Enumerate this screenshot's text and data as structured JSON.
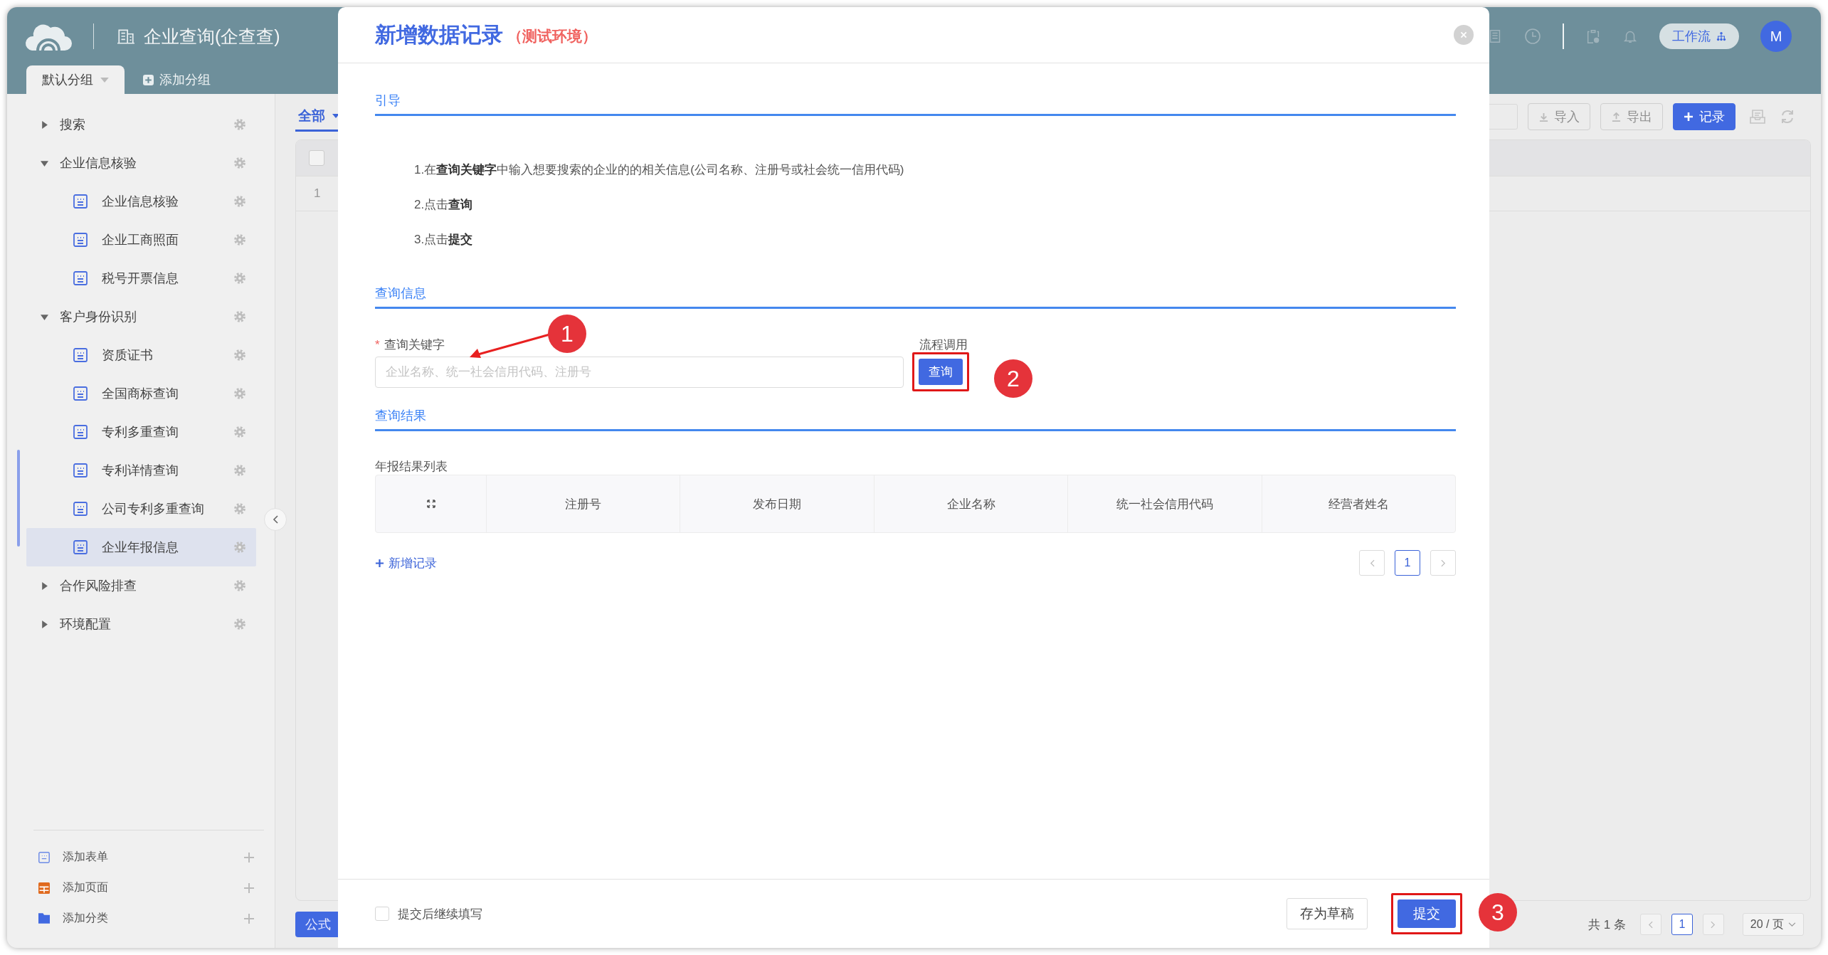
{
  "app": {
    "title": "企业查询(企查查)",
    "group_tab": {
      "label": "默认分组",
      "selected": true
    },
    "add_group_button": "添加分组",
    "workflow_button": "工作流",
    "avatar": "M"
  },
  "sidebar": {
    "tree": [
      {
        "label": "搜索",
        "kind": "folder",
        "expanded": false,
        "selected": false
      },
      {
        "label": "企业信息核验",
        "kind": "folder",
        "expanded": true,
        "selected": false,
        "children": [
          {
            "label": "企业信息核验",
            "kind": "form",
            "selected": false
          },
          {
            "label": "企业工商照面",
            "kind": "form",
            "selected": false
          },
          {
            "label": "税号开票信息",
            "kind": "form",
            "selected": false
          }
        ]
      },
      {
        "label": "客户身份识别",
        "kind": "folder",
        "expanded": true,
        "selected": false,
        "children": [
          {
            "label": "资质证书",
            "kind": "form",
            "selected": false
          },
          {
            "label": "全国商标查询",
            "kind": "form",
            "selected": false
          },
          {
            "label": "专利多重查询",
            "kind": "form",
            "selected": false
          },
          {
            "label": "专利详情查询",
            "kind": "form",
            "selected": false
          },
          {
            "label": "公司专利多重查询",
            "kind": "form",
            "selected": false
          },
          {
            "label": "企业年报信息",
            "kind": "form",
            "selected": true
          }
        ]
      },
      {
        "label": "合作风险排查",
        "kind": "folder",
        "expanded": false,
        "selected": false
      },
      {
        "label": "环境配置",
        "kind": "folder",
        "expanded": false,
        "selected": false
      }
    ],
    "footer_items": [
      {
        "label": "添加表单",
        "kind": "form"
      },
      {
        "label": "添加页面",
        "kind": "page"
      },
      {
        "label": "添加分类",
        "kind": "category"
      }
    ]
  },
  "main": {
    "filter_tab": "全部",
    "toolbar": [
      {
        "label": "导入",
        "kind": "import"
      },
      {
        "label": "导出",
        "kind": "export"
      },
      {
        "label": "记录",
        "kind": "add"
      }
    ],
    "table": {
      "select_all": {
        "checked": false
      },
      "rows": [
        {
          "index": "1"
        }
      ]
    },
    "formula_button": "公式",
    "pager": {
      "total": "共 1 条",
      "page": "1",
      "page_size": "20 / 页"
    }
  },
  "modal": {
    "title": "新增数据记录",
    "env_tag": "（测试环境）",
    "guide": {
      "heading": "引导",
      "steps": [
        "1.在**查询关键字**中输入想要搜索的企业的的相关信息(公司名称、注册号或社会统一信用代码)",
        "2.点击**查询**",
        "3.点击**提交**"
      ]
    },
    "query": {
      "heading": "查询信息",
      "keyword_field": {
        "label": "查询关键字",
        "required_mark": "*",
        "placeholder": "企业名称、统一社会信用代码、注册号"
      },
      "process_call": {
        "label": "流程调用",
        "button": "查询",
        "highlighted": true
      }
    },
    "results": {
      "heading": "查询结果",
      "list_title": "年报结果列表",
      "table": {
        "columns": [
          "注册号",
          "发布日期",
          "企业名称",
          "统一社会信用代码",
          "经营者姓名"
        ]
      },
      "add_record": "新增记录",
      "pager": {
        "page": "1"
      }
    },
    "footer": {
      "continue_checkbox": {
        "label": "提交后继续填写",
        "checked": false
      },
      "buttons": [
        {
          "label": "存为草稿",
          "kind": "secondary",
          "highlighted": false
        },
        {
          "label": "提交",
          "kind": "primary",
          "highlighted": true
        }
      ]
    }
  },
  "annotations": {
    "markers": [
      {
        "label": "1"
      },
      {
        "label": "2"
      },
      {
        "label": "3"
      }
    ]
  }
}
